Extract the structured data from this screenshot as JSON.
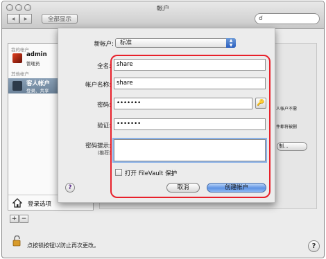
{
  "window": {
    "title": "帐户"
  },
  "toolbar": {
    "show_all": "全部显示",
    "back": "◀",
    "forward": "▶"
  },
  "sidebar": {
    "my_account_header": "我的帐户",
    "my_account": {
      "name": "admin",
      "role": "管理员"
    },
    "other_header": "其他帐户",
    "guest": {
      "name": "客人帐户",
      "detail": "登录、共享"
    },
    "login_options": "登录选项",
    "add": "+",
    "remove": "−"
  },
  "background": {
    "right_text_1": "人帐户不需",
    "right_text_2": "件都将被删",
    "right_button": "制..."
  },
  "footer": {
    "lock_text": "点按锁按钮以防止再次更改。",
    "help": "?"
  },
  "sheet": {
    "new_account_label": "新帐户:",
    "new_account_value": "标准",
    "full_name_label": "全名:",
    "full_name_value": "share",
    "account_name_label": "帐户名称:",
    "account_name_value": "share",
    "password_label": "密码:",
    "password_value": "•••••••",
    "verify_label": "验证:",
    "verify_value": "•••••••",
    "hint_label": "密码提示:",
    "hint_sub": "(推荐)",
    "hint_value": "",
    "filevault_label": "打开 FileVault 保护",
    "help": "?",
    "cancel": "取消",
    "create": "创建帐户"
  }
}
